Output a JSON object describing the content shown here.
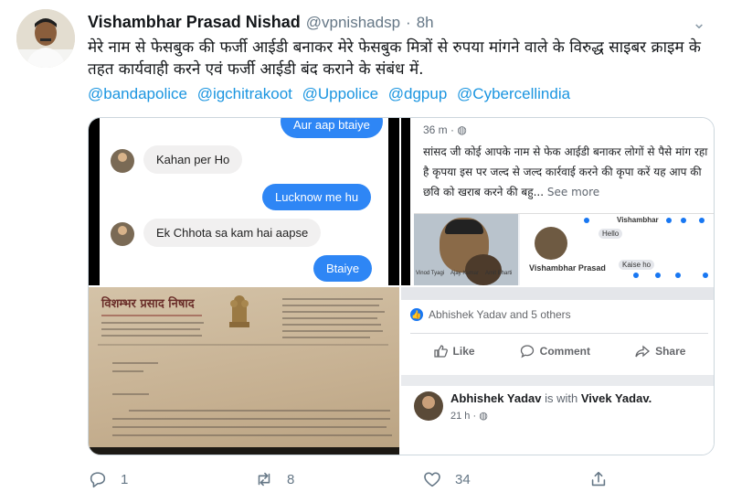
{
  "tweet": {
    "display_name": "Vishambhar Prasad Nishad",
    "handle": "@vpnishadsp",
    "separator": "·",
    "time": "8h",
    "text": "मेरे नाम से फेसबुक की फर्जी आईडी बनाकर मेरे फेसबुक मित्रों से रुपया मांगने वाले के विरुद्ध साइबर क्राइम के तहत कार्यवाही करने एवं फर्जी आईडी बंद कराने के संबंध में.",
    "mentions": [
      "@bandapolice",
      "@igchitrakoot",
      "@Uppolice",
      "@dgpup",
      "@Cybercellindia"
    ],
    "reply_count": "1",
    "retweet_count": "8",
    "like_count": "34"
  },
  "media": {
    "chat": {
      "cut_top_message": "Aur aap btaiye",
      "messages": [
        {
          "from": "them",
          "text": "Kahan per Ho"
        },
        {
          "from": "me",
          "text": "Lucknow me hu"
        },
        {
          "from": "them",
          "text": "Ek Chhota sa kam hai aapse"
        },
        {
          "from": "me",
          "text": "Btaiye"
        }
      ]
    },
    "fb_post": {
      "time": "36 m · ",
      "text": "सांसद जी कोई आपके नाम से फेक आईडी बनाकर लोगों से पैसे मांग रहा है कृपया इस पर जल्द से जल्द कार्रवाई करने की कृपा करें यह आप की छवि को खराब करने की बहु...",
      "see_more": "See more",
      "screenshot_name": "Vishambhar Prasad",
      "screenshot_header": "Vishambhar",
      "screenshot_msg1": "Hello",
      "screenshot_msg2": "Kaise ho",
      "screenshot_friends": [
        "Vinod Tyagi",
        "Ajay Kumar",
        "Amit Bharti"
      ]
    },
    "letter": {
      "title": "विशम्भर प्रसाद निषाद"
    },
    "fb_actions": {
      "reactions": "Abhishek Yadav and 5 others",
      "like": "Like",
      "comment": "Comment",
      "share": "Share",
      "post2_name": "Abhishek Yadav",
      "post2_is_with": "is with",
      "post2_with": "Vivek Yadav.",
      "post2_time": "21 h · "
    }
  },
  "colors": {
    "link": "#1b95e0",
    "muted": "#657786",
    "messenger_blue": "#2e86f5",
    "facebook_blue": "#1877f2"
  },
  "icons": [
    "chevron-down-icon",
    "reply-icon",
    "retweet-icon",
    "like-icon",
    "share-icon",
    "globe-icon",
    "thumbs-up-icon",
    "comment-icon",
    "fb-share-icon"
  ]
}
